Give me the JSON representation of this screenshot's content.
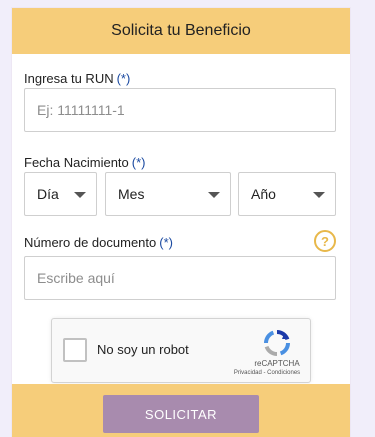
{
  "header": {
    "title": "Solicita tu Beneficio"
  },
  "form": {
    "run": {
      "label": "Ingresa tu RUN",
      "required": "(*)",
      "placeholder": "Ej: 11111111-1"
    },
    "birth_date": {
      "label": "Fecha Nacimiento",
      "required": "(*)",
      "day": "Día",
      "month": "Mes",
      "year": "Año"
    },
    "document": {
      "label": "Número de documento",
      "required": "(*)",
      "placeholder": "Escribe aquí",
      "help_icon": "?"
    }
  },
  "captcha": {
    "label": "No soy un robot",
    "brand": "reCAPTCHA",
    "links": "Privacidad - Condiciones"
  },
  "footer": {
    "submit_label": "SOLICITAR"
  },
  "colors": {
    "accent": "#f6cd7a",
    "required": "#1b4aa1",
    "submit_background": "#a88bae",
    "help_icon": "#e8b84a"
  },
  "icons": {
    "dropdown": "chevron-down-icon",
    "help": "question-circle-icon",
    "recaptcha": "recaptcha-logo-icon"
  }
}
